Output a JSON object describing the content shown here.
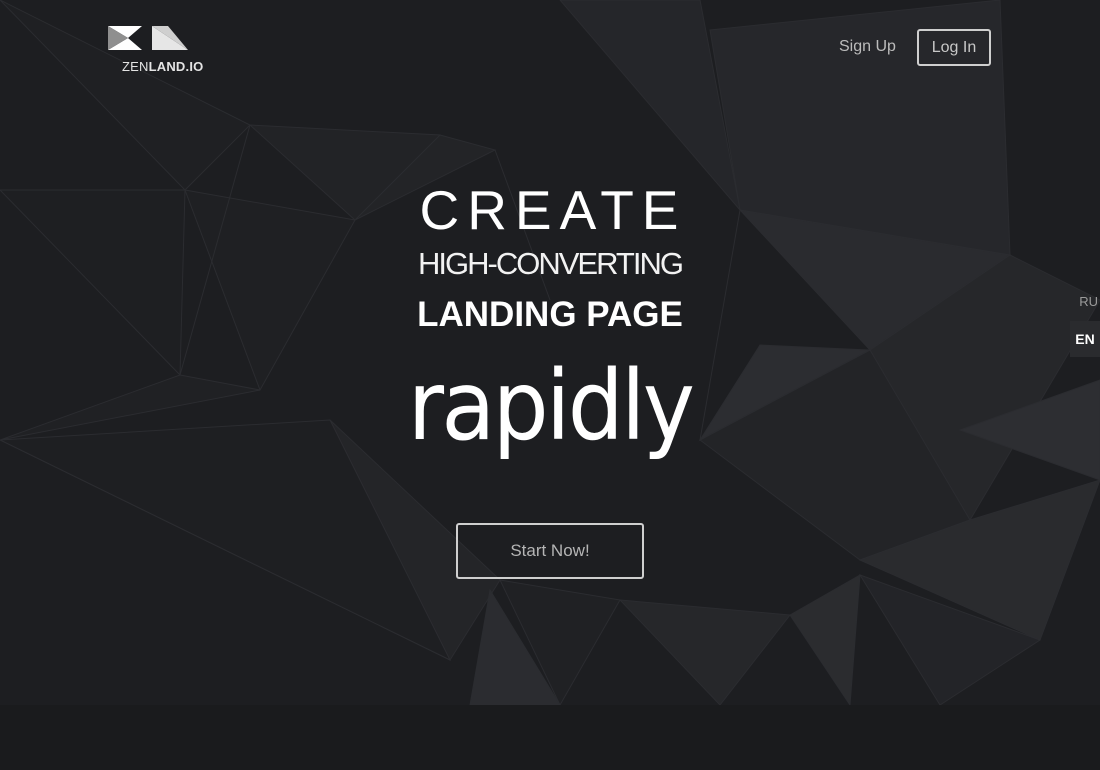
{
  "brand": {
    "logo_light": "ZEN",
    "logo_bold": "LAND.IO"
  },
  "nav": {
    "signup_label": "Sign Up",
    "login_label": "Log In"
  },
  "languages": {
    "ru": "RU",
    "en": "EN",
    "active": "EN"
  },
  "hero": {
    "line1": "CREATE",
    "line2": "HIGH-CONVERTING",
    "line3": "LANDING PAGE",
    "line4": "rapidly",
    "cta_label": "Start Now!"
  },
  "colors": {
    "background": "#1d1e21",
    "text": "#ffffff",
    "button_border": "#cfcfcf"
  }
}
